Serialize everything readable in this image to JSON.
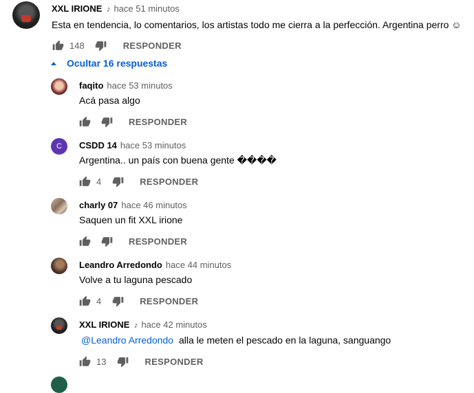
{
  "main_comment": {
    "author": "XXL IRIONE",
    "time": "hace 51 minutos",
    "text": "Esta en tendencia, lo comentarios, los artistas todo me cierra a la perfección. Argentina perro ☺",
    "likes": "148",
    "reply_label": "RESPONDER"
  },
  "replies_toggle": {
    "label": "Ocultar 16 respuestas"
  },
  "replies": [
    {
      "author": "faqito",
      "time": "hace 53 minutos",
      "text": "Acá pasa algo",
      "likes": "",
      "reply_label": "RESPONDER"
    },
    {
      "author": "CSDD 14",
      "time": "hace 53 minutos",
      "text": "Argentina.. un país con buena gente ����",
      "likes": "4",
      "reply_label": "RESPONDER",
      "avatar_letter": "C"
    },
    {
      "author": "charly 07",
      "time": "hace 46 minutos",
      "text": "Saquen  un fit XXL irione",
      "likes": "",
      "reply_label": "RESPONDER"
    },
    {
      "author": "Leandro Arredondo",
      "time": "hace 44 minutos",
      "text": "Volve a tu laguna pescado",
      "likes": "4",
      "reply_label": "RESPONDER"
    },
    {
      "author": "XXL IRIONE",
      "time": "hace 42 minutos",
      "mention": "@Leandro Arredondo",
      "text": "alla le meten el pescado en la laguna, sanguango",
      "likes": "13",
      "reply_label": "RESPONDER"
    }
  ],
  "colors": {
    "link": "#065fd4",
    "meta": "#606060",
    "text": "#030303",
    "csdd_avatar": "#5e35b1"
  },
  "icons": [
    "music-note-icon",
    "thumb-up-icon",
    "thumb-down-icon",
    "caret-up-icon"
  ]
}
